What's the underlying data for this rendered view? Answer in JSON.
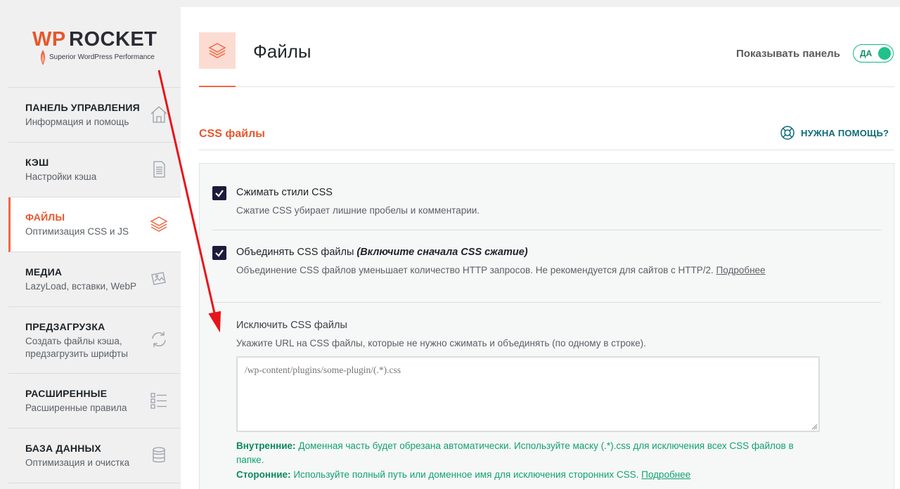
{
  "logo": {
    "brand_wp": "WP",
    "brand_rocket": "ROCKET",
    "tagline": "Superior WordPress Performance"
  },
  "sidebar": {
    "items": [
      {
        "title": "ПАНЕЛЬ УПРАВЛЕНИЯ",
        "subtitle": "Информация и помощь",
        "icon": "home-icon"
      },
      {
        "title": "КЭШ",
        "subtitle": "Настройки кэша",
        "icon": "page-icon"
      },
      {
        "title": "ФАЙЛЫ",
        "subtitle": "Оптимизация CSS и JS",
        "icon": "layers-icon",
        "active": true
      },
      {
        "title": "МЕДИА",
        "subtitle": "LazyLoad, вставки, WebP",
        "icon": "images-icon"
      },
      {
        "title": "ПРЕДЗАГРУЗКА",
        "subtitle": "Создать файлы кэша, предзагрузить шрифты",
        "icon": "refresh-icon"
      },
      {
        "title": "РАСШИРЕННЫЕ",
        "subtitle": "Расширенные правила",
        "icon": "list-icon"
      },
      {
        "title": "БАЗА ДАННЫХ",
        "subtitle": "Оптимизация и очистка",
        "icon": "database-icon"
      }
    ]
  },
  "header": {
    "title": "Файлы",
    "show_panel_label": "Показывать панель",
    "toggle_label": "ДА",
    "toggle_on": true
  },
  "section": {
    "title": "CSS файлы",
    "help_label": "НУЖНА ПОМОЩЬ?"
  },
  "options": {
    "minify": {
      "checked": true,
      "label": "Сжимать стили CSS",
      "description": "Сжатие CSS убирает лишние пробелы и комментарии."
    },
    "combine": {
      "checked": true,
      "label": "Объединять CSS файлы",
      "label_note": "(Включите сначала CSS сжатие)",
      "description": "Объединение CSS файлов уменьшает количество HTTP запросов. Не рекомендуется для сайтов с HTTP/2.",
      "more_link": "Подробнее"
    },
    "exclude": {
      "title": "Исключить CSS файлы",
      "description": "Укажите URL на CSS файлы, которые не нужно сжимать и объединять (по одному в строке).",
      "placeholder": "/wp-content/plugins/some-plugin/(.*).css",
      "value": "",
      "hint_internal_label": "Внутренние:",
      "hint_internal_text": "Доменная часть будет обрезана автоматически. Используйте маску (.*).css для исключения всех CSS файлов в папке.",
      "hint_external_label": "Сторонние:",
      "hint_external_text": "Используйте полный путь или доменное имя для исключения сторонних CSS.",
      "hint_more_link": "Подробнее"
    }
  },
  "colors": {
    "accent": "#f56640",
    "checkbox": "#1e1a3b",
    "toggle": "#22c08a",
    "help": "#0e6b77",
    "hint": "#10a36e",
    "annotation_arrow": "#e8141b"
  }
}
